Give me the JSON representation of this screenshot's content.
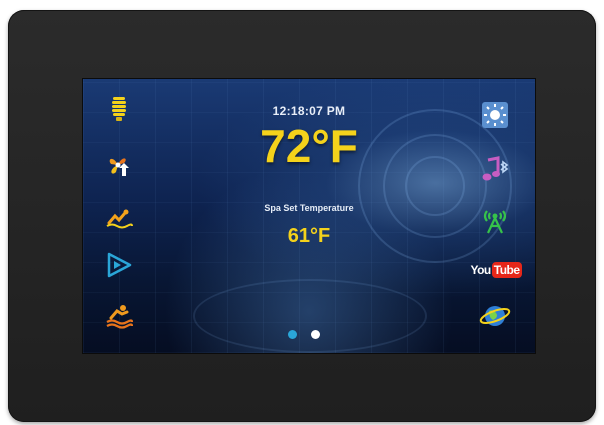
{
  "display": {
    "time": "12:18:07 PM",
    "current_temp": "72°F",
    "set_label": "Spa Set Temperature",
    "set_temp": "61°F"
  },
  "left_icons": [
    {
      "name": "light-icon",
      "color": "#f4d21b"
    },
    {
      "name": "blower-icon",
      "color": "#f09a1e"
    },
    {
      "name": "pool-pump-icon",
      "color": "#f4a31b"
    },
    {
      "name": "play-triangle-icon",
      "color": "#2aa6d8"
    },
    {
      "name": "swimmer-icon",
      "color": "#f09a1e"
    }
  ],
  "right_icons": [
    {
      "name": "settings-sun-icon",
      "color": "#6aa6e0"
    },
    {
      "name": "bluetooth-music-icon",
      "color": "#c85dc2"
    },
    {
      "name": "wifi-tower-icon",
      "color": "#36c24a"
    },
    {
      "name": "youtube-logo",
      "you": "You",
      "tube": "Tube"
    },
    {
      "name": "internet-planet-icon",
      "color": "#3b8fe0"
    }
  ],
  "pager": {
    "pages": 2,
    "active_index": 1
  }
}
